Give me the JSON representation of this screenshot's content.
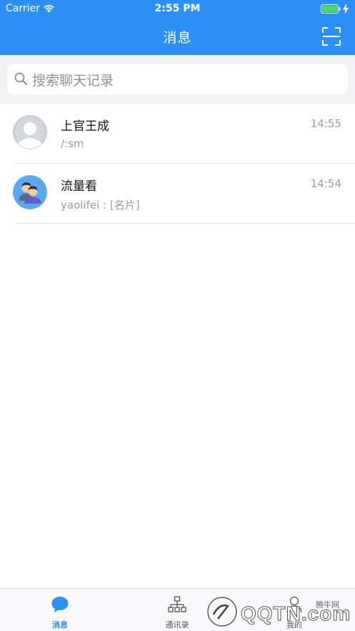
{
  "status_bar": {
    "carrier": "Carrier",
    "time": "2:55 PM"
  },
  "nav": {
    "title": "消息",
    "scan_icon": "scan-icon"
  },
  "search": {
    "placeholder": "搜索聊天记录",
    "icon": "search-icon"
  },
  "conversations": [
    {
      "name": "上官王成",
      "time": "14:55",
      "preview": "/:sm",
      "avatar": "default-person-avatar"
    },
    {
      "name": "流量看",
      "time": "14:54",
      "preview": "yaolifei : [名片]",
      "avatar": "group-avatar"
    }
  ],
  "tabs": [
    {
      "label": "消息",
      "icon": "chat-bubble-icon",
      "active": true
    },
    {
      "label": "通讯录",
      "icon": "org-chart-icon",
      "active": false
    },
    {
      "label": "我的",
      "icon": "person-icon",
      "active": false
    }
  ],
  "watermark": {
    "text": "QQTN.com",
    "small": "腾牛网"
  },
  "colors": {
    "primary": "#2b8ff5",
    "background": "#f1f1f4",
    "secondary_text": "#9b9b9b"
  }
}
